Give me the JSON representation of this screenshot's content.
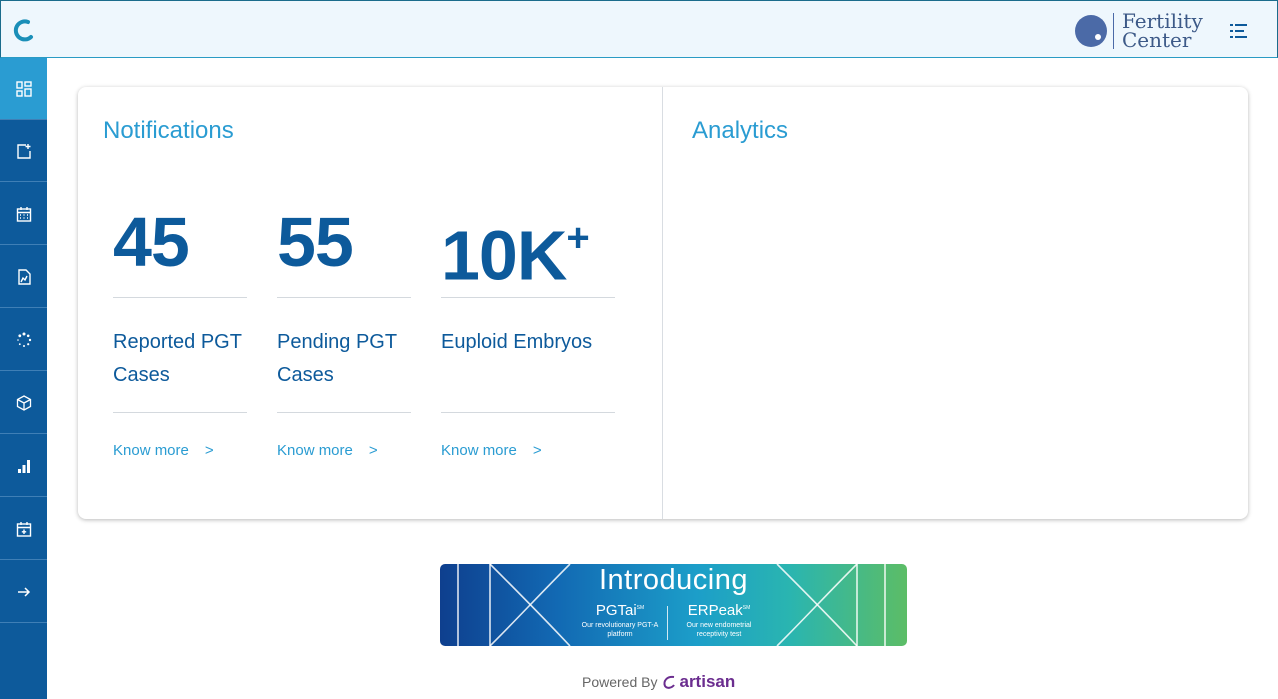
{
  "header": {
    "logo_icon": "c-logo-icon",
    "brand_line1": "Fertility",
    "brand_line2": "Center",
    "menu_icon": "list-menu-icon"
  },
  "sidebar": {
    "items": [
      {
        "icon": "dashboard-icon",
        "active": true
      },
      {
        "icon": "add-document-icon"
      },
      {
        "icon": "calendar-icon"
      },
      {
        "icon": "report-icon"
      },
      {
        "icon": "loading-icon"
      },
      {
        "icon": "cube-icon"
      },
      {
        "icon": "bar-chart-icon"
      },
      {
        "icon": "calendar-plus-icon"
      },
      {
        "icon": "arrow-right-icon"
      }
    ]
  },
  "notifications": {
    "title": "Notifications",
    "stats": [
      {
        "value": "45",
        "label": "Reported PGT Cases",
        "link": "Know more"
      },
      {
        "value": "55",
        "label": "Pending PGT Cases",
        "link": "Know more"
      },
      {
        "value": "10K",
        "suffix": "+",
        "label": "Euploid Embryos",
        "link": "Know more"
      }
    ],
    "chevron": ">"
  },
  "analytics": {
    "title": "Analytics"
  },
  "banner": {
    "headline": "Introducing",
    "product1": {
      "name": "PGTai",
      "mark": "SM",
      "desc": "Our revolutionary PGT-A platform"
    },
    "product2": {
      "name": "ERPeak",
      "mark": "SM",
      "desc": "Our new endometrial receptivity test"
    }
  },
  "footer": {
    "powered_by": "Powered By",
    "brand": "artisan"
  },
  "colors": {
    "primary": "#0d5a9b",
    "accent": "#2a9cd2",
    "artisan": "#6b2d8f"
  }
}
